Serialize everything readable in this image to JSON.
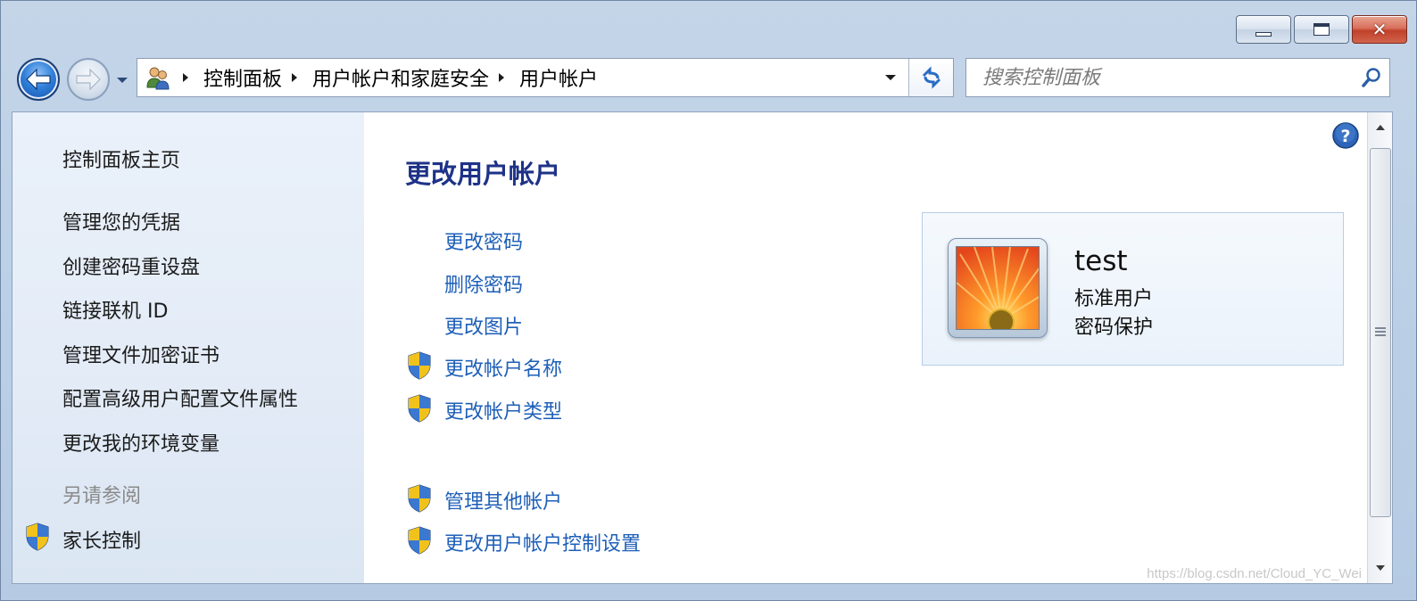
{
  "window": {
    "controls": {
      "minimize": "minimize",
      "maximize": "maximize",
      "close": "close"
    }
  },
  "address_bar": {
    "breadcrumbs": [
      "控制面板",
      "用户帐户和家庭安全",
      "用户帐户"
    ]
  },
  "search": {
    "placeholder": "搜索控制面板"
  },
  "sidebar": {
    "home": "控制面板主页",
    "items": [
      "管理您的凭据",
      "创建密码重设盘",
      "链接联机 ID",
      "管理文件加密证书",
      "配置高级用户配置文件属性",
      "更改我的环境变量"
    ],
    "see_also_heading": "另请参阅",
    "see_also_items": [
      "家长控制"
    ]
  },
  "main": {
    "title": "更改用户帐户",
    "tasks": [
      "更改密码",
      "删除密码",
      "更改图片"
    ],
    "admin_tasks": [
      "更改帐户名称",
      "更改帐户类型"
    ],
    "other_tasks": [
      "管理其他帐户",
      "更改用户帐户控制设置"
    ]
  },
  "account": {
    "name": "test",
    "type": "标准用户",
    "status": "密码保护"
  },
  "watermark": "https://blog.csdn.net/Cloud_YC_Wei",
  "icons": {
    "back": "back-arrow-icon",
    "forward": "forward-arrow-icon",
    "address": "users-icon",
    "refresh": "refresh-icon",
    "search": "search-icon",
    "help": "help-icon",
    "shield": "uac-shield-icon"
  },
  "colors": {
    "link": "#1e5fb8",
    "title": "#1e3287",
    "sidebar_bg": "#e4ecf7",
    "frame": "#bcd0e6"
  }
}
